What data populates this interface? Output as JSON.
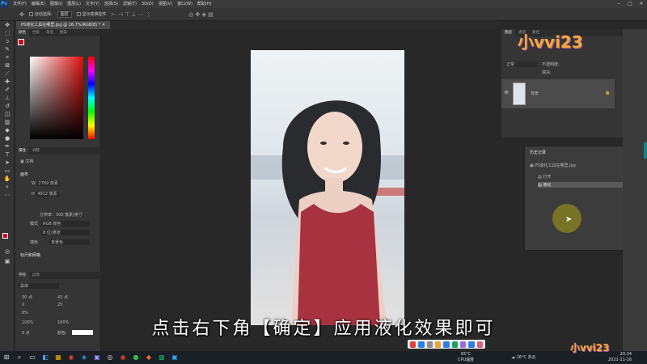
{
  "menu": {
    "items": [
      "文件(F)",
      "编辑(E)",
      "图像(I)",
      "图层(L)",
      "文字(Y)",
      "选择(S)",
      "滤镜(T)",
      "3D(D)",
      "视图(V)",
      "窗口(W)",
      "帮助(H)"
    ]
  },
  "options": {
    "auto_select_label": "自动选择:",
    "layer_select": "图层",
    "show_transform_label": "显示变换控件"
  },
  "document": {
    "tab_title": "PS液化工具在哪里.jpg @ 16.7%(RGB/8) *"
  },
  "color_panel": {
    "tabs": [
      "颜色",
      "色板",
      "渐变",
      "图案"
    ]
  },
  "properties_panel": {
    "tabs": [
      "属性",
      "调整"
    ],
    "section_doc": "文档",
    "section_canvas": "画布",
    "width_label": "W",
    "width_value": "2769 像素",
    "height_label": "H",
    "height_value": "4912 像素",
    "resolution_text": "分辨率：300 像素/英寸",
    "mode_label": "模式",
    "mode_value": "RGB 颜色",
    "bitdepth_value": "8 位/通道",
    "fill_label": "填色",
    "fill_value": "背景色",
    "rulers_label": "标尺和网格"
  },
  "character_panel": {
    "tabs": [
      "字符",
      "段落"
    ],
    "font_value": "黑体",
    "size_value": "30 点",
    "leading_value": "43 点",
    "va_value": "0",
    "tracking_value": "25",
    "scale_value": "0%",
    "vscale_value": "100%",
    "hscale_value": "100%",
    "baseline_value": "0 点",
    "color_label": "颜色:"
  },
  "layers_panel": {
    "tabs": [
      "图层",
      "通道",
      "路径"
    ],
    "kind_label": "正常",
    "opacity_label": "不透明度:",
    "fill_label": "填充:",
    "layer_name": "背景"
  },
  "history_panel": {
    "title": "历史记录",
    "snapshot": "PS液化工具在哪里.jpg",
    "steps": [
      "打开",
      "液化"
    ]
  },
  "subtitle": "点击右下角【确定】应用液化效果即可",
  "watermark": "小vvi23",
  "taskbar": {
    "temp": "65°C",
    "cpu_label": "CPU温度",
    "weather": "16°C 多云",
    "time": "20:34",
    "date": "2021-11-16"
  },
  "colors": {
    "accent": "#31a8ff",
    "foreground_swatch": "#d0021b",
    "background_swatch": "#ffffff",
    "cursor_highlight": "#e6dc00",
    "dress": "#a8323f"
  }
}
